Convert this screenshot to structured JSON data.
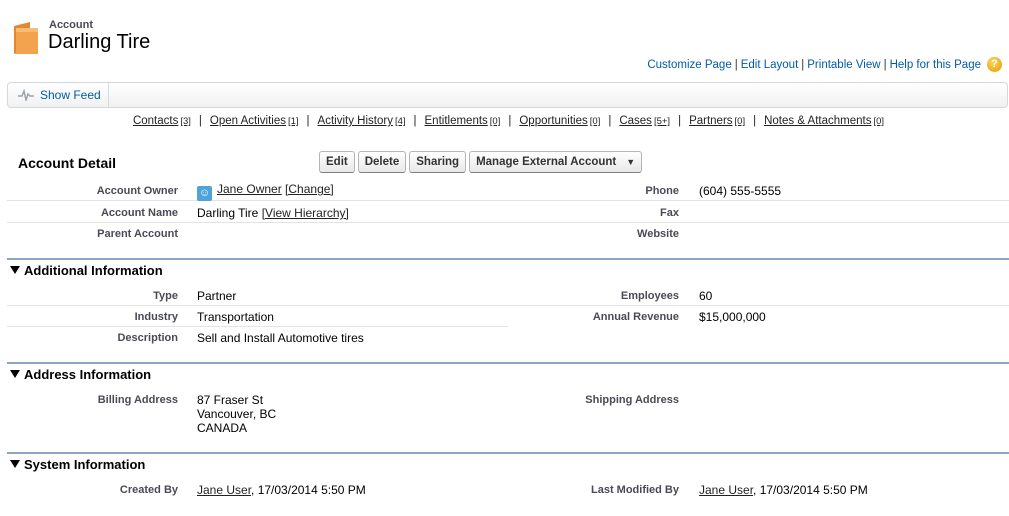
{
  "header": {
    "object_type": "Account",
    "record_name": "Darling Tire"
  },
  "top_links": {
    "customize": "Customize Page",
    "edit_layout": "Edit Layout",
    "printable": "Printable View",
    "help": "Help for this Page",
    "separator": "|"
  },
  "feed": {
    "show_feed": "Show Feed"
  },
  "related": [
    {
      "name": "Contacts",
      "count": "[3]"
    },
    {
      "name": "Open Activities",
      "count": "[1]"
    },
    {
      "name": "Activity History",
      "count": "[4]"
    },
    {
      "name": "Entitlements",
      "count": "[0]"
    },
    {
      "name": "Opportunities",
      "count": "[0]"
    },
    {
      "name": "Cases",
      "count": "[5+]"
    },
    {
      "name": "Partners",
      "count": "[0]"
    },
    {
      "name": "Notes & Attachments",
      "count": "[0]"
    }
  ],
  "detail": {
    "title": "Account Detail",
    "buttons": {
      "edit": "Edit",
      "delete": "Delete",
      "sharing": "Sharing",
      "manage": "Manage External Account"
    },
    "account_owner_label": "Account Owner",
    "account_owner": "Jane Owner",
    "change": "[Change]",
    "phone_label": "Phone",
    "phone": "(604) 555-5555",
    "account_name_label": "Account Name",
    "account_name": "Darling Tire",
    "view_hierarchy": "[View Hierarchy]",
    "fax_label": "Fax",
    "parent_account_label": "Parent Account",
    "website_label": "Website"
  },
  "additional": {
    "title": "Additional Information",
    "type_label": "Type",
    "type": "Partner",
    "employees_label": "Employees",
    "employees": "60",
    "industry_label": "Industry",
    "industry": "Transportation",
    "revenue_label": "Annual Revenue",
    "revenue": "$15,000,000",
    "description_label": "Description",
    "description": "Sell and Install Automotive tires"
  },
  "address": {
    "title": "Address Information",
    "billing_label": "Billing Address",
    "billing_line1": "87 Fraser St",
    "billing_line2": "Vancouver, BC",
    "billing_line3": "CANADA",
    "shipping_label": "Shipping Address"
  },
  "system": {
    "title": "System Information",
    "created_label": "Created By",
    "created_user": "Jane User",
    "created_date": ", 17/03/2014 5:50 PM",
    "modified_label": "Last Modified By",
    "modified_user": "Jane User",
    "modified_date": ", 17/03/2014 5:50 PM"
  },
  "colors": {
    "link": "#015ba7",
    "section_rule": "#8da4c3",
    "label": "#4a4a56",
    "folder": "#f3a34d"
  },
  "icons": {
    "record": "folder-icon",
    "help": "help-icon",
    "feed": "pulse-icon",
    "owner": "user-avatar-icon",
    "collapse": "triangle-down-icon"
  }
}
